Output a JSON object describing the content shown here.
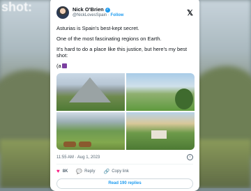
{
  "background": {
    "ghost_text": "shot:"
  },
  "tweet": {
    "name": "Nick O'Brien",
    "handle": "@NickLovesSpain",
    "separator": "·",
    "follow_label": "Follow",
    "paragraphs": [
      "Asturias is Spain's best-kept secret.",
      "One of the most fascinating regions on Earth.",
      "It's hard to do a place like this justice, but here's my best shot:"
    ],
    "emoji_line": "(a",
    "timestamp": "11:55 AM · Aug 1, 2023",
    "likes": "8K",
    "reply_label": "Reply",
    "copy_link_label": "Copy link",
    "read_replies_label": "Read 190 replies"
  },
  "colors": {
    "accent": "#1d9bf0",
    "like": "#f91880",
    "text": "#0f1419",
    "muted": "#536471"
  },
  "icons": {
    "close": "x-logo-icon",
    "verified": "verified-badge-icon",
    "info": "info-icon"
  }
}
